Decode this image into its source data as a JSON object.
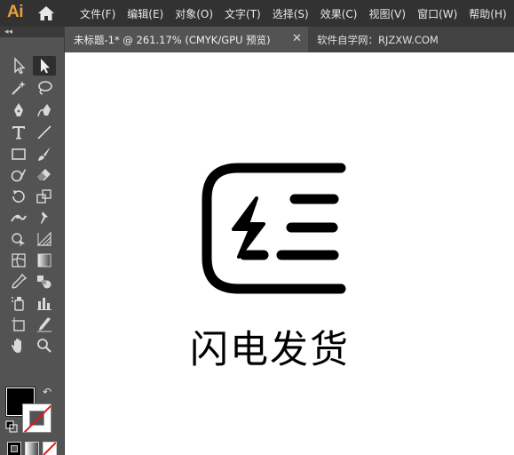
{
  "app": {
    "logo": "Ai",
    "accent_color": "#e8a03b"
  },
  "menu": {
    "items": [
      "文件(F)",
      "编辑(E)",
      "对象(O)",
      "文字(T)",
      "选择(S)",
      "效果(C)",
      "视图(V)",
      "窗口(W)",
      "帮助(H)"
    ]
  },
  "tabs": {
    "document_title": "未标题-1* @ 261.17% (CMYK/GPU 预览)",
    "close_symbol": "✕",
    "extra_text": "软件自学网：RJZXW.COM"
  },
  "toolbar": {
    "collapse_symbol": "◂◂",
    "swap_symbol": "↶",
    "fill_color": "#000000",
    "stroke_color": "none",
    "tools": [
      "selection-tool",
      "direct-selection-tool",
      "magic-wand-tool",
      "lasso-tool",
      "pen-tool",
      "curvature-tool",
      "type-tool",
      "line-segment-tool",
      "rectangle-tool",
      "paintbrush-tool",
      "shaper-tool",
      "eraser-tool",
      "rotate-tool",
      "scale-tool",
      "width-tool",
      "puppet-warp-tool",
      "shape-builder-tool",
      "perspective-grid-tool",
      "mesh-tool",
      "gradient-tool",
      "eyedropper-tool",
      "blend-tool",
      "symbol-sprayer-tool",
      "column-graph-tool",
      "artboard-tool",
      "slice-tool",
      "hand-tool",
      "zoom-tool"
    ]
  },
  "artwork": {
    "caption": "闪电发货",
    "icon": "lightning-delivery-icon"
  }
}
